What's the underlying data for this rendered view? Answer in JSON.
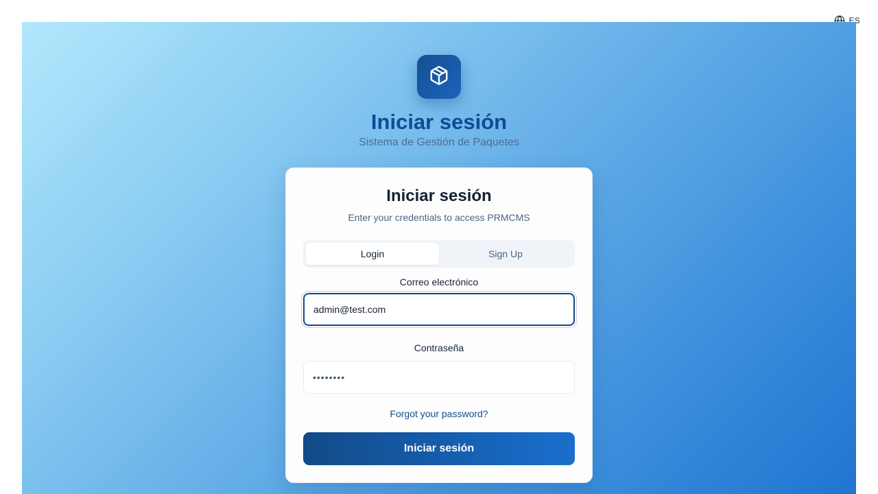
{
  "language": {
    "code": "ES",
    "icon": "globe-icon"
  },
  "hero": {
    "logo_icon": "package-icon",
    "title": "Iniciar sesión",
    "subtitle": "Sistema de Gestión de Paquetes"
  },
  "card": {
    "title": "Iniciar sesión",
    "description": "Enter your credentials to access PRMCMS",
    "tabs": [
      {
        "label": "Login",
        "active": true
      },
      {
        "label": "Sign Up",
        "active": false
      }
    ],
    "email": {
      "label": "Correo electrónico",
      "value": "admin@test.com"
    },
    "password": {
      "label": "Contraseña",
      "value": "••••••••"
    },
    "forgot_link": "Forgot your password?",
    "submit_label": "Iniciar sesión"
  },
  "colors": {
    "brand_dark": "#134a86",
    "brand": "#1a64bd",
    "title": "#0f4c94"
  }
}
